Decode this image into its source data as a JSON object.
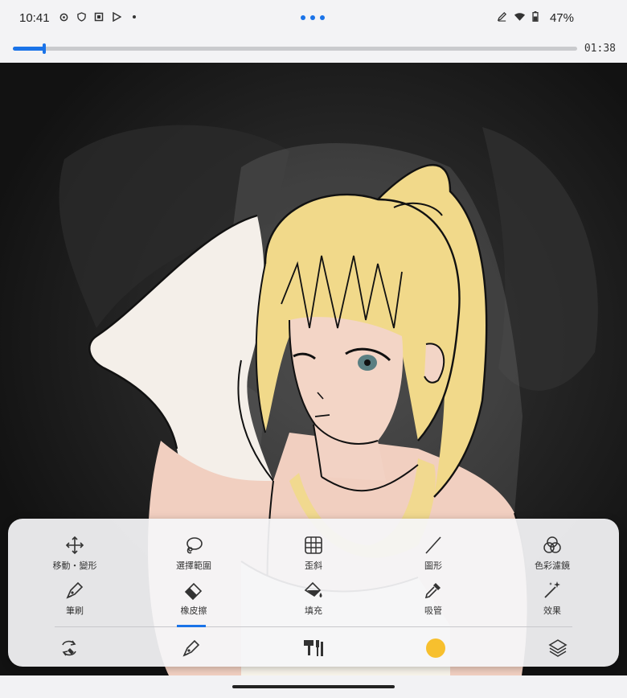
{
  "status_bar": {
    "time": "10:41",
    "left_icons": [
      "gear-icon",
      "shield-icon",
      "screen-record-icon",
      "play-store-icon",
      "notification-dot-icon"
    ],
    "right_icons": [
      "pen-icon",
      "wifi-icon",
      "battery-icon"
    ],
    "battery": "47%"
  },
  "playback": {
    "elapsed": "01:38",
    "progress": 0.055,
    "accent": "#1a73e8"
  },
  "canvas": {
    "description_colors": {
      "background": "#151515",
      "hair": "#f1d98a",
      "skin": "#f2cfc0",
      "outline": "#111111"
    }
  },
  "tools": {
    "row1": [
      {
        "label": "移動・變形",
        "icon": "move-transform-icon"
      },
      {
        "label": "選擇範圍",
        "icon": "lasso-select-icon"
      },
      {
        "label": "歪斜",
        "icon": "perspective-grid-icon"
      },
      {
        "label": "圖形",
        "icon": "line-shape-icon"
      },
      {
        "label": "色彩濾鏡",
        "icon": "color-filter-icon"
      }
    ],
    "row2": [
      {
        "label": "筆刷",
        "icon": "brush-pen-icon"
      },
      {
        "label": "橡皮擦",
        "icon": "eraser-icon"
      },
      {
        "label": "填充",
        "icon": "fill-bucket-icon"
      },
      {
        "label": "吸管",
        "icon": "eyedropper-icon"
      },
      {
        "label": "效果",
        "icon": "magic-wand-icon"
      }
    ],
    "active_tool": "橡皮擦"
  },
  "bottom_bar": {
    "buttons": [
      "swap-tool-icon",
      "brush-pen-icon",
      "brush-library-icon",
      "color-swatch",
      "layers-icon"
    ],
    "current_color": "#f7c02e"
  }
}
